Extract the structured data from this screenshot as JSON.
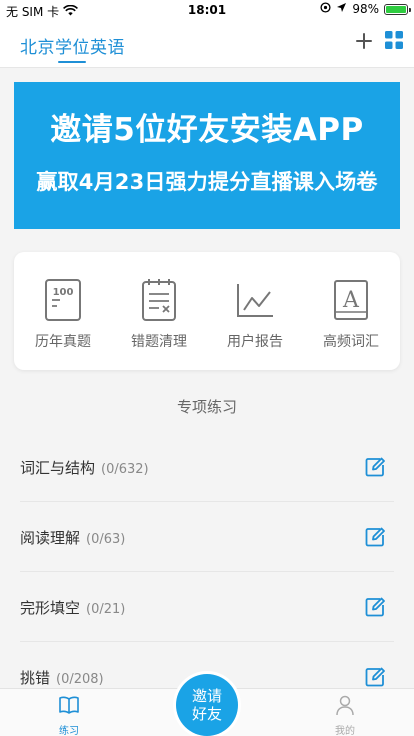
{
  "status_bar": {
    "carrier": "无 SIM 卡",
    "time": "18:01",
    "battery": "98%",
    "battery_level": 0.98,
    "icons": [
      "wifi-icon",
      "alarm-icon",
      "location-icon",
      "battery-icon"
    ]
  },
  "nav": {
    "title": "北京学位英语",
    "icons": [
      "plus-icon",
      "grid-icon"
    ]
  },
  "banner": {
    "line1": "邀请5位好友安装APP",
    "line2": "赢取4月23日强力提分直播课入场卷"
  },
  "quick_menu": [
    {
      "label": "历年真题",
      "icon": "past-exam-icon"
    },
    {
      "label": "错题清理",
      "icon": "wrong-questions-icon"
    },
    {
      "label": "用户报告",
      "icon": "report-chart-icon"
    },
    {
      "label": "高频词汇",
      "icon": "vocabulary-book-icon"
    }
  ],
  "section": {
    "title": "专项练习"
  },
  "practice_items": [
    {
      "name": "词汇与结构",
      "count": "(0/632)"
    },
    {
      "name": "阅读理解",
      "count": "(0/63)"
    },
    {
      "name": "完形填空",
      "count": "(0/21)"
    },
    {
      "name": "挑错",
      "count": "(0/208)"
    }
  ],
  "tab_bar": {
    "practice": "练习",
    "invite_line1": "邀请",
    "invite_line2": "好友",
    "mine": "我的"
  },
  "colors": {
    "accent": "#1e8fd6",
    "banner": "#1aa3e6",
    "battery": "#2ecc40"
  }
}
